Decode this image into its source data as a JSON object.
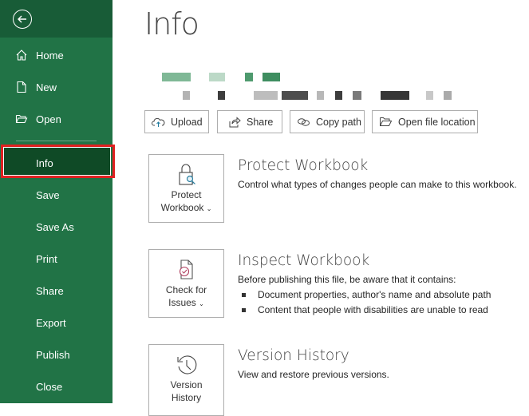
{
  "sidebar": {
    "back_icon": "back-arrow-circle-icon",
    "items": [
      {
        "label": "Home",
        "icon": "home-icon"
      },
      {
        "label": "New",
        "icon": "new-document-icon"
      },
      {
        "label": "Open",
        "icon": "folder-open-icon"
      },
      {
        "label": "Info",
        "active": true
      },
      {
        "label": "Save"
      },
      {
        "label": "Save As"
      },
      {
        "label": "Print"
      },
      {
        "label": "Share"
      },
      {
        "label": "Export"
      },
      {
        "label": "Publish"
      },
      {
        "label": "Close"
      }
    ]
  },
  "main": {
    "title": "Info",
    "file_name_redacted": true,
    "file_path_redacted": true,
    "actions": [
      {
        "label": "Upload",
        "icon": "cloud-upload-icon"
      },
      {
        "label": "Share",
        "icon": "share-icon"
      },
      {
        "label": "Copy path",
        "icon": "link-icon"
      },
      {
        "label": "Open file location",
        "icon": "folder-open-icon"
      }
    ],
    "sections": [
      {
        "button_line1": "Protect",
        "button_line2": "Workbook",
        "button_icon": "lock-key-icon",
        "title": "Protect Workbook",
        "description": "Control what types of changes people can make to this workbook."
      },
      {
        "button_line1": "Check for",
        "button_line2": "Issues",
        "button_icon": "document-check-icon",
        "title": "Inspect Workbook",
        "description": "Before publishing this file, be aware that it contains:",
        "bullets": [
          "Document properties, author's name and absolute path",
          "Content that people with disabilities are unable to read"
        ]
      },
      {
        "button_line1": "Version",
        "button_line2": "History",
        "button_icon": "history-clock-icon",
        "title": "Version History",
        "description": "View and restore previous versions."
      }
    ]
  },
  "colors": {
    "sidebar_bg": "#217346",
    "sidebar_active": "#0e4a26",
    "highlight": "#e02020"
  }
}
